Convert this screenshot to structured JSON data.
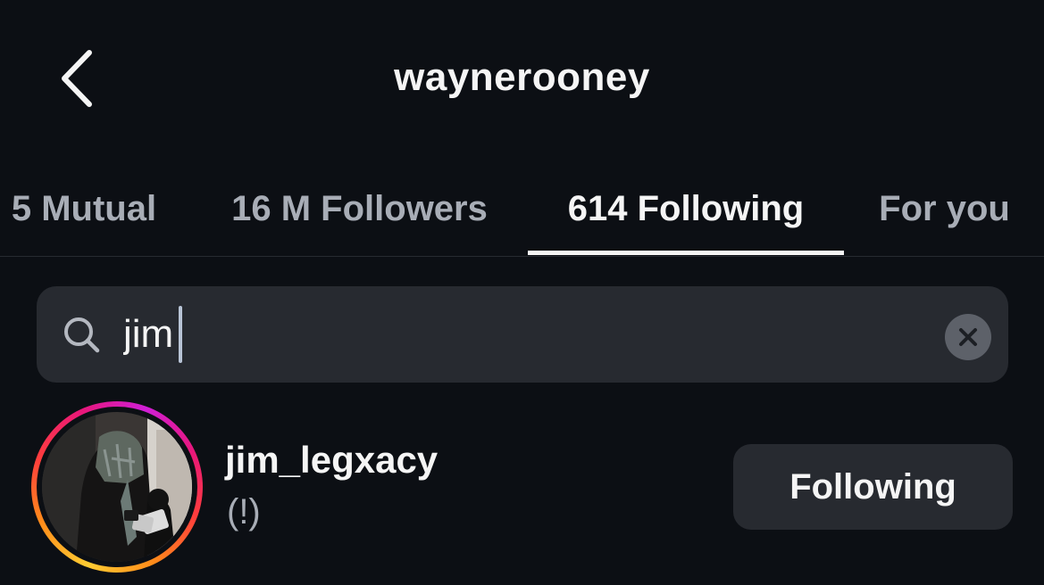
{
  "header": {
    "back_icon": "chevron-left-icon",
    "title": "waynerooney"
  },
  "tabs": [
    {
      "label": "5 Mutual",
      "active": false
    },
    {
      "label": "16 M Followers",
      "active": false
    },
    {
      "label": "614 Following",
      "active": true
    },
    {
      "label": "For you",
      "active": false
    }
  ],
  "search": {
    "icon": "search-icon",
    "value": "jim",
    "clear_icon": "close-icon"
  },
  "results": [
    {
      "username": "jim_legxacy",
      "subtitle": "(!)",
      "button_label": "Following",
      "has_story_ring": true
    }
  ],
  "colors": {
    "background": "#0c0f14",
    "surface": "#272a30",
    "text_primary": "#f5f5f5",
    "text_secondary": "#a8adb6"
  }
}
